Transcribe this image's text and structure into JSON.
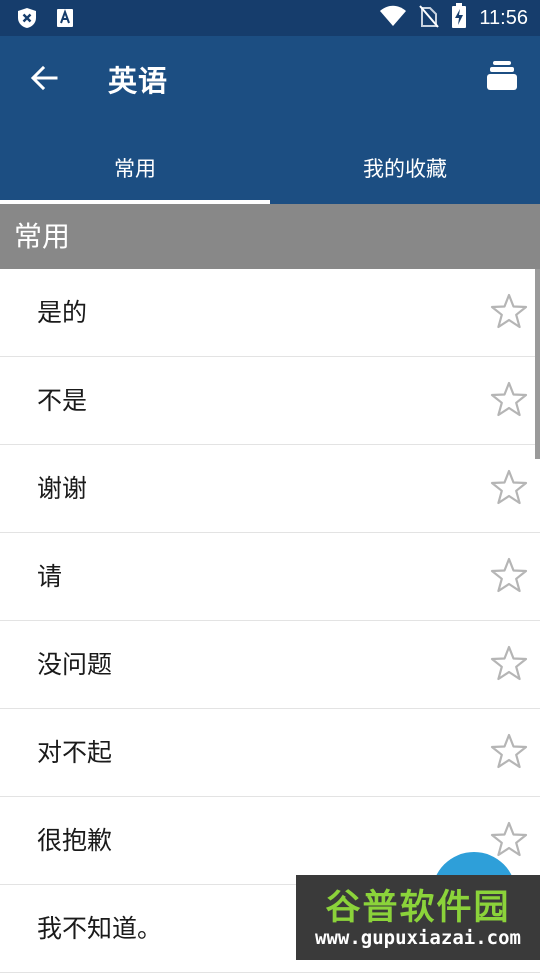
{
  "status_bar": {
    "time": "11:56",
    "icons": [
      "shield-x-icon",
      "font-a-icon",
      "wifi-icon",
      "no-sim-icon",
      "battery-charging-icon"
    ]
  },
  "app_bar": {
    "title": "英语",
    "back_icon": "arrow-left-icon",
    "action_icon": "stack-icon"
  },
  "tabs": [
    {
      "label": "常用",
      "selected": true
    },
    {
      "label": "我的收藏",
      "selected": false
    }
  ],
  "section": {
    "header": "常用"
  },
  "phrases": [
    {
      "text": "是的",
      "favorite": false
    },
    {
      "text": "不是",
      "favorite": false
    },
    {
      "text": "谢谢",
      "favorite": false
    },
    {
      "text": "请",
      "favorite": false
    },
    {
      "text": "没问题",
      "favorite": false
    },
    {
      "text": "对不起",
      "favorite": false
    },
    {
      "text": "很抱歉",
      "favorite": false
    },
    {
      "text": "我不知道。",
      "favorite": false
    }
  ],
  "watermark": {
    "title": "谷普软件园",
    "url": "www.gupuxiazai.com"
  },
  "colors": {
    "status_bar": "#163d6c",
    "app_bar": "#1c4e82",
    "section_header": "#888888",
    "fab": "#2e9fd9",
    "star_outline": "#b5b5b5"
  }
}
